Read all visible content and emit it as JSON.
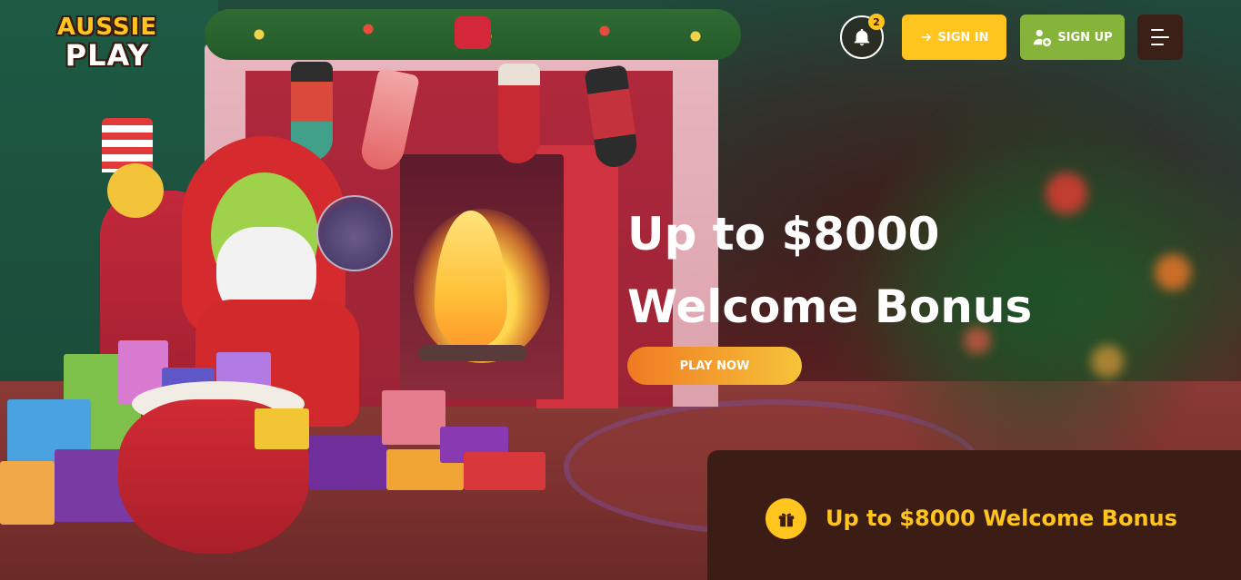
{
  "logo": {
    "line1": "AUSSIE",
    "line2": "PLAY"
  },
  "header": {
    "notification_count": "2",
    "signin_label": "SIGN IN",
    "signup_label": "SIGN UP"
  },
  "hero": {
    "title_line1": "Up to $8000",
    "title_line2": "Welcome Bonus",
    "play_label": "PLAY NOW"
  },
  "bonus_panel": {
    "text": "Up to $8000 Welcome Bonus"
  },
  "colors": {
    "brand_yellow": "#ffc41e",
    "signup_green": "#86b43a",
    "panel_brown": "#3b1d16",
    "play_gradient_start": "#f07a22",
    "play_gradient_end": "#f6c43a"
  },
  "icons": {
    "bell": "bell-icon",
    "signin": "arrow-right-icon",
    "signup": "user-plus-icon",
    "menu": "hamburger-menu-icon",
    "gift": "gift-icon"
  }
}
